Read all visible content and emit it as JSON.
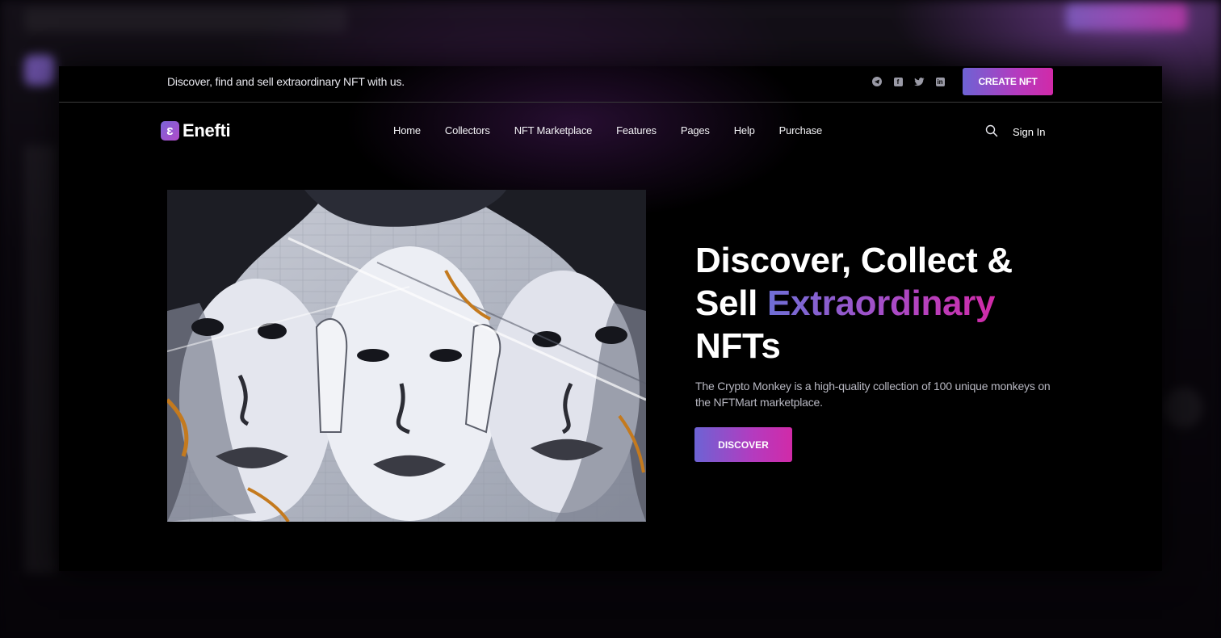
{
  "topbar": {
    "tagline": "Discover, find and sell extraordinary NFT with us.",
    "socials": [
      "telegram-icon",
      "facebook-icon",
      "twitter-icon",
      "linkedin-icon"
    ],
    "create_label": "CREATE NFT"
  },
  "nav": {
    "logo_mark": "ɛ",
    "logo_text": "Enefti",
    "items": [
      {
        "label": "Home"
      },
      {
        "label": "Collectors"
      },
      {
        "label": "NFT Marketplace"
      },
      {
        "label": "Features"
      },
      {
        "label": "Pages"
      },
      {
        "label": "Help"
      },
      {
        "label": "Purchase"
      }
    ],
    "signin_label": "Sign In"
  },
  "hero": {
    "title_line1": "Discover, Collect &",
    "title_line2_prefix": "Sell ",
    "title_line2_highlight": "Extraordinary",
    "title_line3": "NFTs",
    "description": "The Crypto Monkey is a high-quality collection of 100 unique monkeys on the NFTMart marketplace.",
    "discover_label": "DISCOVER"
  },
  "colors": {
    "accent_start": "#6d63d4",
    "accent_end": "#d12aa8",
    "background": "#000000"
  }
}
